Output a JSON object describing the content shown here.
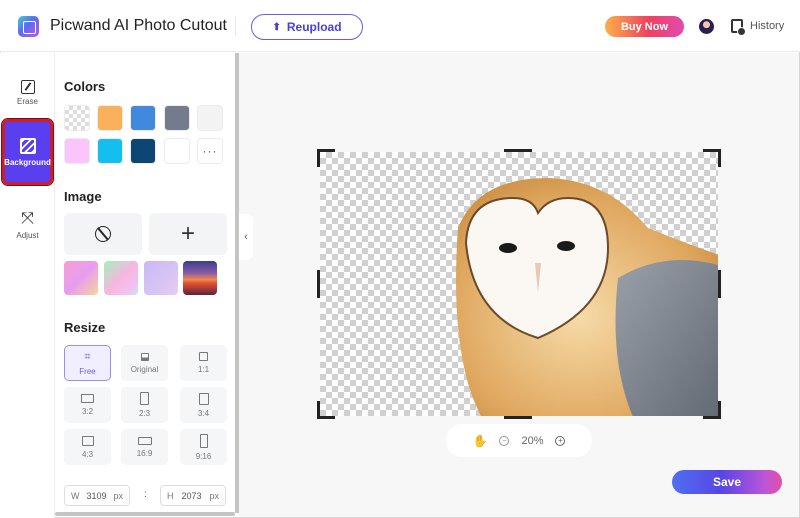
{
  "header": {
    "app_title": "Picwand AI Photo Cutout",
    "reupload_label": "Reupload",
    "buy_now_label": "Buy Now",
    "history_label": "History"
  },
  "rail": {
    "items": [
      {
        "label": "Erase",
        "icon": "eraser-icon",
        "active": false
      },
      {
        "label": "Background",
        "icon": "background-icon",
        "active": true
      },
      {
        "label": "Adjust",
        "icon": "adjust-icon",
        "active": false
      }
    ]
  },
  "panel": {
    "colors_title": "Colors",
    "colors": [
      "transparent",
      "#fbb05c",
      "#4089dc",
      "#747b8c",
      "#f3f3f3",
      "#fbc4fb",
      "#14bff0",
      "#0c4674",
      "#ffffff",
      "more"
    ],
    "more_label": "···",
    "image_title": "Image",
    "image_buttons": [
      {
        "icon": "no-image-icon",
        "glyph": "⃠"
      },
      {
        "icon": "add-image-icon",
        "glyph": "+"
      }
    ],
    "image_thumbs": [
      "pink-gradient",
      "pastel-bokeh",
      "lavender",
      "sunset"
    ],
    "resize_title": "Resize",
    "resize_options": [
      {
        "label": "Free",
        "active": true
      },
      {
        "label": "Original",
        "active": false
      },
      {
        "label": "1:1",
        "active": false
      },
      {
        "label": "3:2",
        "active": false
      },
      {
        "label": "2:3",
        "active": false
      },
      {
        "label": "3:4",
        "active": false
      },
      {
        "label": "4:3",
        "active": false
      },
      {
        "label": "16:9",
        "active": false
      },
      {
        "label": "9:16",
        "active": false
      }
    ],
    "width": {
      "prefix": "W",
      "value": "3109",
      "unit": "px"
    },
    "height": {
      "prefix": "H",
      "value": "2073",
      "unit": "px"
    },
    "dim_separator": ":"
  },
  "workspace": {
    "collapse_glyph": "‹",
    "zoom_level": "20%",
    "zoom_out_glyph": "−",
    "zoom_in_glyph": "+",
    "hand_glyph": "✋",
    "save_label": "Save"
  }
}
